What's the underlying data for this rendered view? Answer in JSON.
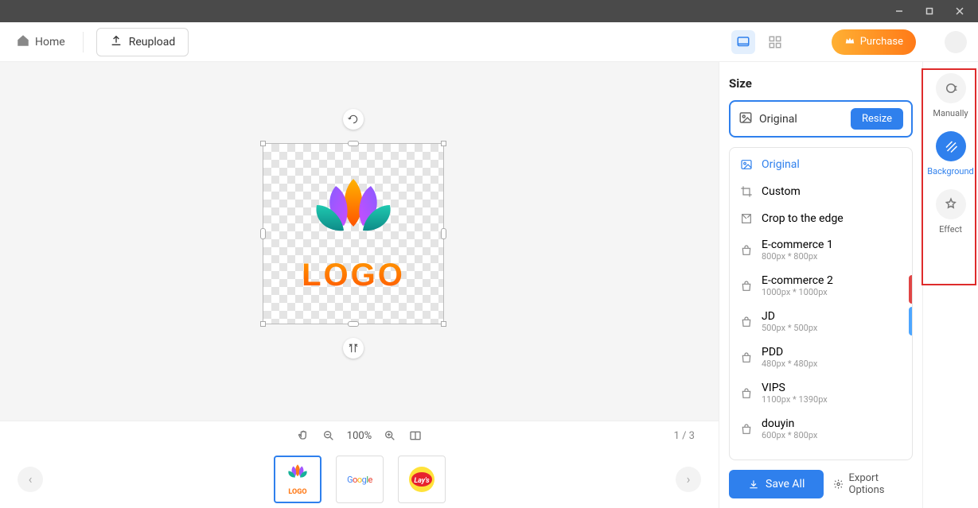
{
  "window": {
    "minimize": "—",
    "maximize": "▢",
    "close": "✕"
  },
  "toolbar": {
    "home": "Home",
    "reupload": "Reupload",
    "purchase": "Purchase"
  },
  "canvas": {
    "logo_text": "LOGO",
    "zoom": "100%",
    "page_indicator": "1 / 3",
    "thumbs": [
      "LOGO",
      "Google",
      "Lay's"
    ]
  },
  "size_panel": {
    "title": "Size",
    "current": "Original",
    "resize_btn": "Resize",
    "items": [
      {
        "icon": "image",
        "label": "Original",
        "sub": "",
        "active": true
      },
      {
        "icon": "crop",
        "label": "Custom",
        "sub": ""
      },
      {
        "icon": "edge",
        "label": "Crop to the edge",
        "sub": ""
      },
      {
        "icon": "bag",
        "label": "E-commerce 1",
        "sub": "800px * 800px"
      },
      {
        "icon": "bag",
        "label": "E-commerce 2",
        "sub": "1000px * 1000px"
      },
      {
        "icon": "bag",
        "label": "JD",
        "sub": "500px * 500px"
      },
      {
        "icon": "bag",
        "label": "PDD",
        "sub": "480px * 480px"
      },
      {
        "icon": "bag",
        "label": "VIPS",
        "sub": "1100px * 1390px"
      },
      {
        "icon": "bag",
        "label": "douyin",
        "sub": "600px * 800px"
      }
    ],
    "save_all": "Save All",
    "export_options": "Export Options"
  },
  "rail": {
    "manually": "Manually",
    "background": "Background",
    "effect": "Effect"
  }
}
